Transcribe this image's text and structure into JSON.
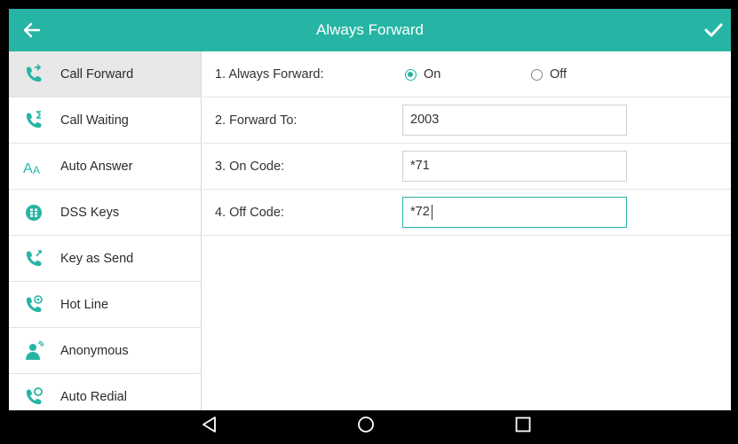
{
  "header": {
    "title": "Always Forward",
    "back_icon": "arrow-left-icon",
    "confirm_icon": "check-icon",
    "accent": "#26b5a4"
  },
  "sidebar": {
    "items": [
      {
        "label": "Call Forward",
        "icon": "call-forward-icon",
        "active": true
      },
      {
        "label": "Call Waiting",
        "icon": "call-waiting-icon",
        "active": false
      },
      {
        "label": "Auto Answer",
        "icon": "auto-answer-icon",
        "active": false
      },
      {
        "label": "DSS Keys",
        "icon": "dss-keys-icon",
        "active": false
      },
      {
        "label": "Key as Send",
        "icon": "key-as-send-icon",
        "active": false
      },
      {
        "label": "Hot Line",
        "icon": "hot-line-icon",
        "active": false
      },
      {
        "label": "Anonymous",
        "icon": "anonymous-icon",
        "active": false
      },
      {
        "label": "Auto Redial",
        "icon": "auto-redial-icon",
        "active": false
      }
    ]
  },
  "form": {
    "always_forward": {
      "label": "1. Always Forward:",
      "options": [
        "On",
        "Off"
      ],
      "selected": "On"
    },
    "forward_to": {
      "label": "2. Forward To:",
      "value": "2003"
    },
    "on_code": {
      "label": "3. On Code:",
      "value": "*71"
    },
    "off_code": {
      "label": "4. Off Code:",
      "value": "*72"
    }
  },
  "navbar": {
    "icons": [
      "back-triangle-icon",
      "home-circle-icon",
      "recents-square-icon"
    ]
  }
}
